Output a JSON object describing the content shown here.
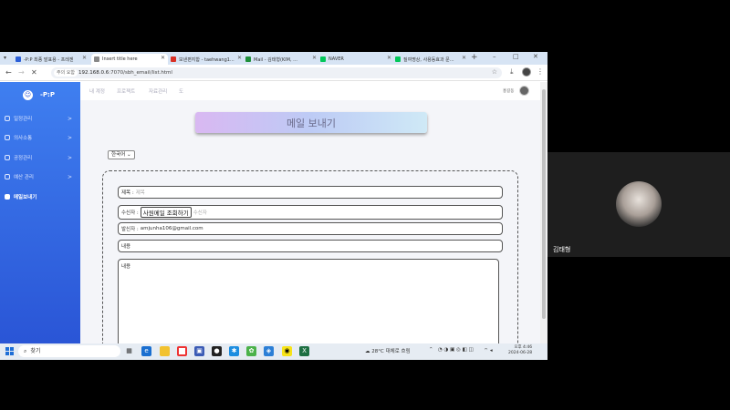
{
  "browser": {
    "tabs": [
      {
        "label": "-P:P 최종 발표용 - 프레젠",
        "color": "#2b5fd8"
      },
      {
        "label": "Insert title here",
        "color": "#888888",
        "active": true
      },
      {
        "label": "보낸편지함 - taehwang1...",
        "color": "#d93025"
      },
      {
        "label": "Mail - 김태형(KIM, ...",
        "color": "#1f8f3a"
      },
      {
        "label": "NAVER",
        "color": "#03c75a"
      },
      {
        "label": "질여명상, 사용동효과 문...",
        "color": "#03c75a"
      }
    ],
    "tab_list_icon": "dropdown-icon",
    "new_tab_label": "+",
    "security_label": "주의 요함",
    "url_host": "192.168.0.6",
    "url_path": ":7070/sbh_email/list.html",
    "window_controls": [
      "–",
      "□",
      "✕"
    ]
  },
  "sidebar": {
    "brand": "-P:P",
    "items": [
      {
        "label": "일정관리",
        "chevron": ">"
      },
      {
        "label": "의사소통",
        "chevron": ">"
      },
      {
        "label": "공정관리",
        "chevron": ">"
      },
      {
        "label": "예산 관리",
        "chevron": ">"
      },
      {
        "label": "메일보내기",
        "chevron": "",
        "active": true
      }
    ]
  },
  "topnav": {
    "items": [
      "내 계정",
      "프로젝트",
      "자료관리",
      "도"
    ],
    "user": "홍길동"
  },
  "main": {
    "title": "메일 보내기",
    "language": "한국어",
    "subject_label": "제목 :",
    "subject_placeholder": "제목",
    "recipient_label": "수신자 :",
    "recipient_button": "사원메일 조회하기",
    "recipient_placeholder": "수신자",
    "sender_label": "발신자 :",
    "sender_value": "amjunha106@gmail.com",
    "content_label": "내용",
    "body_placeholder": "내용"
  },
  "taskbar": {
    "search": "찾기",
    "weather": "28°C 대체로 흐림",
    "time": "오후 4:46",
    "date": "2024-06-28"
  },
  "video": {
    "participant": "김태형"
  },
  "colors": {
    "sidebar": "#3f7ff0",
    "accent": "#2a55d6"
  }
}
